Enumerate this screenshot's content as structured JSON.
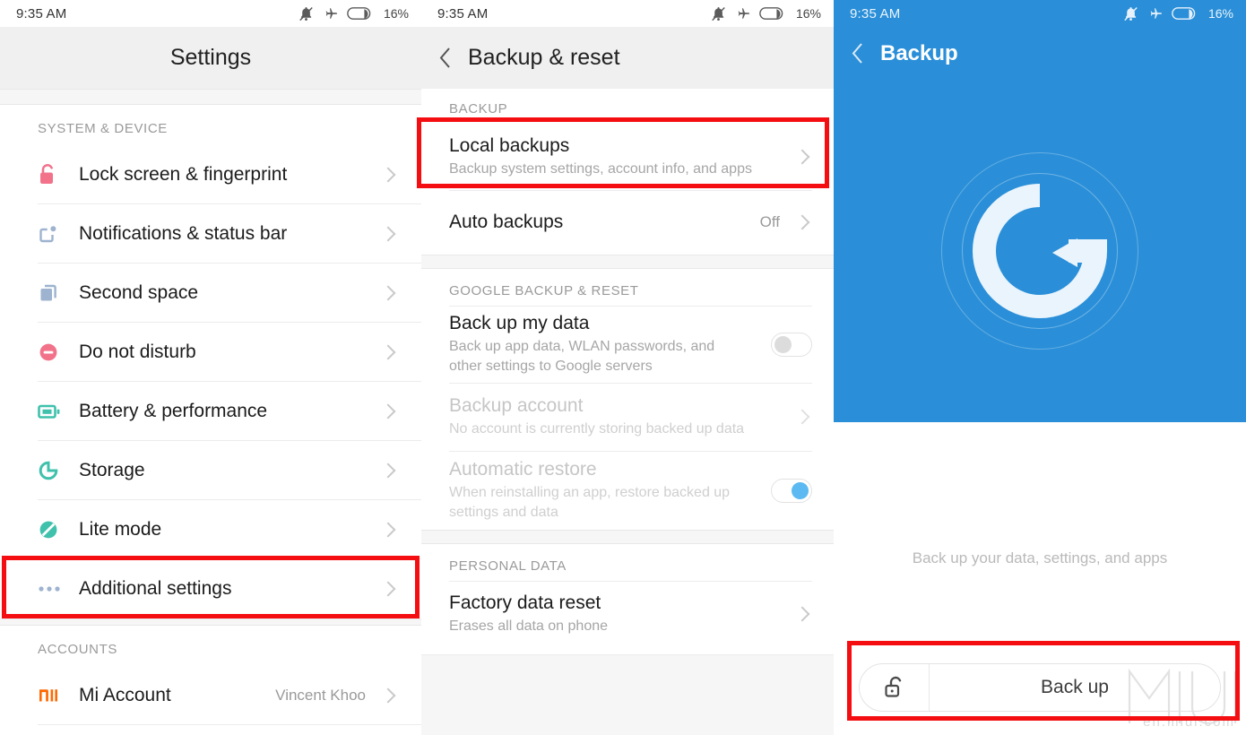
{
  "statusbar": {
    "time": "9:35 AM",
    "battery_percent": "16%",
    "icons": [
      "bell-muted-icon",
      "airplane-mode-icon",
      "battery-icon"
    ]
  },
  "settings_screen": {
    "title": "Settings",
    "groups": [
      {
        "header": "SYSTEM & DEVICE",
        "items": [
          {
            "label": "Lock screen & fingerprint",
            "icon": "lock-icon",
            "value": "",
            "chevron": true
          },
          {
            "label": "Notifications & status bar",
            "icon": "notifications-icon",
            "value": "",
            "chevron": true
          },
          {
            "label": "Second space",
            "icon": "second-space-icon",
            "value": "",
            "chevron": true
          },
          {
            "label": "Do not disturb",
            "icon": "do-not-disturb-icon",
            "value": "",
            "chevron": true
          },
          {
            "label": "Battery & performance",
            "icon": "battery-icon",
            "value": "",
            "chevron": true
          },
          {
            "label": "Storage",
            "icon": "storage-icon",
            "value": "",
            "chevron": true
          },
          {
            "label": "Lite mode",
            "icon": "lite-mode-icon",
            "value": "",
            "chevron": true
          },
          {
            "label": "Additional settings",
            "icon": "more-dots-icon",
            "value": "",
            "chevron": true
          }
        ]
      },
      {
        "header": "ACCOUNTS",
        "items": [
          {
            "label": "Mi Account",
            "icon": "mi-logo-icon",
            "value": "Vincent Khoo",
            "chevron": true
          }
        ]
      }
    ]
  },
  "backup_reset_screen": {
    "title": "Backup  &  reset",
    "back_icon": "back-chevron-icon",
    "groups": [
      {
        "header": "BACKUP",
        "items": [
          {
            "title": "Local backups",
            "subtitle": "Backup system settings, account info, and apps",
            "value": "",
            "control": "chevron",
            "disabled": false
          },
          {
            "title": "Auto backups",
            "subtitle": "",
            "value": "Off",
            "control": "chevron",
            "disabled": false
          }
        ]
      },
      {
        "header": "GOOGLE BACKUP & RESET",
        "items": [
          {
            "title": "Back up my data",
            "subtitle": "Back up app data, WLAN passwords, and other settings to Google servers",
            "value": "",
            "control": "toggle-off",
            "disabled": false
          },
          {
            "title": "Backup account",
            "subtitle": "No account is currently storing backed up data",
            "value": "",
            "control": "chevron",
            "disabled": true
          },
          {
            "title": "Automatic restore",
            "subtitle": "When reinstalling an app, restore backed up settings and data",
            "value": "",
            "control": "toggle-on",
            "disabled": true
          }
        ]
      },
      {
        "header": "PERSONAL DATA",
        "items": [
          {
            "title": "Factory data reset",
            "subtitle": "Erases all data on phone",
            "value": "",
            "control": "chevron",
            "disabled": false
          }
        ]
      }
    ]
  },
  "backup_screen": {
    "title": "Backup",
    "back_icon": "back-chevron-icon",
    "hero_icon": "backup-restore-circle-icon",
    "caption": "Back up your data, settings, and apps",
    "button": {
      "label": "Back up",
      "icon": "unlock-icon"
    },
    "watermark": {
      "logo": "MIUI",
      "url": "en.miui.com"
    }
  },
  "highlights": [
    {
      "name": "additional-settings-highlight",
      "color": "#f40d11"
    },
    {
      "name": "local-backups-highlight",
      "color": "#f40d11"
    },
    {
      "name": "back-up-button-highlight",
      "color": "#f40d11"
    }
  ],
  "colors": {
    "accent_blue": "#2a8fd8",
    "toggle_on": "#5cb9f2",
    "highlight_red": "#f40d11",
    "titlebar_grey": "#f0f0f0",
    "mi_orange": "#ff6900"
  }
}
